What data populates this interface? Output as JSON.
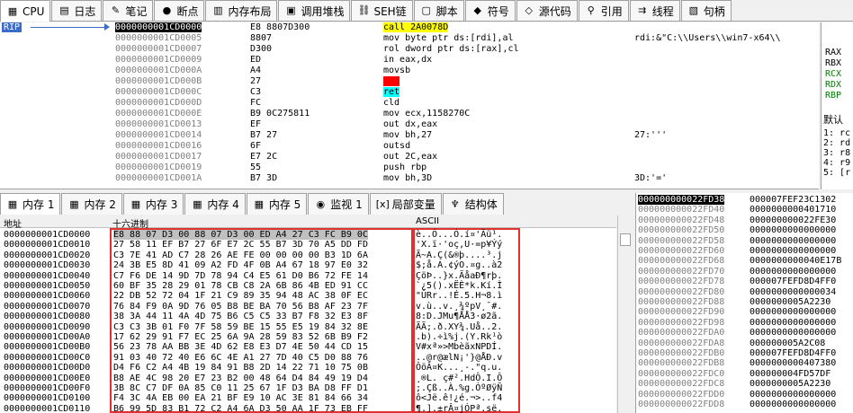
{
  "top_tabs": [
    {
      "label": "CPU",
      "icon": "cpu-icon",
      "glyph": "▦",
      "active": true
    },
    {
      "label": "日志",
      "icon": "log-icon",
      "glyph": "▤"
    },
    {
      "label": "笔记",
      "icon": "notes-icon",
      "glyph": "✎"
    },
    {
      "label": "断点",
      "icon": "breakpoint-icon",
      "glyph": "●"
    },
    {
      "label": "内存布局",
      "icon": "memory-map-icon",
      "glyph": "▥"
    },
    {
      "label": "调用堆栈",
      "icon": "call-stack-icon",
      "glyph": "▣"
    },
    {
      "label": "SEH链",
      "icon": "seh-icon",
      "glyph": "⛓"
    },
    {
      "label": "脚本",
      "icon": "script-icon",
      "glyph": "▢"
    },
    {
      "label": "符号",
      "icon": "symbol-icon",
      "glyph": "◆"
    },
    {
      "label": "源代码",
      "icon": "source-icon",
      "glyph": "◇"
    },
    {
      "label": "引用",
      "icon": "references-icon",
      "glyph": "⚲"
    },
    {
      "label": "线程",
      "icon": "threads-icon",
      "glyph": "⇉"
    },
    {
      "label": "句柄",
      "icon": "handles-icon",
      "glyph": "▧"
    }
  ],
  "rip_label": "RIP",
  "disasm": [
    {
      "addr": "0000000001CD0000",
      "bytes": "E8 8807D300",
      "instr": "call 2A0078D",
      "comment": "",
      "sel": true
    },
    {
      "addr": "0000000001CD0005",
      "bytes": "8807",
      "instr": "mov byte ptr ds:[rdi],al",
      "comment": "rdi:&\"C:\\\\Users\\\\win7-x64\\\\"
    },
    {
      "addr": "0000000001CD0007",
      "bytes": "D300",
      "instr": "rol dword ptr ds:[rax],cl",
      "comment": ""
    },
    {
      "addr": "0000000001CD0009",
      "bytes": "ED",
      "instr": "in eax,dx",
      "comment": ""
    },
    {
      "addr": "0000000001CD000A",
      "bytes": "A4",
      "instr": "movsb",
      "comment": ""
    },
    {
      "addr": "0000000001CD000B",
      "bytes": "27",
      "instr": "???",
      "comment": "",
      "bad": true
    },
    {
      "addr": "0000000001CD000C",
      "bytes": "C3",
      "instr": "ret",
      "comment": "",
      "ret": true
    },
    {
      "addr": "0000000001CD000D",
      "bytes": "FC",
      "instr": "cld",
      "comment": ""
    },
    {
      "addr": "0000000001CD000E",
      "bytes": "B9 0C275811",
      "instr": "mov ecx,1158270C",
      "comment": ""
    },
    {
      "addr": "0000000001CD0013",
      "bytes": "EF",
      "instr": "out dx,eax",
      "comment": ""
    },
    {
      "addr": "0000000001CD0014",
      "bytes": "B7 27",
      "instr": "mov bh,27",
      "comment": "27:'''"
    },
    {
      "addr": "0000000001CD0016",
      "bytes": "6F",
      "instr": "outsd",
      "comment": ""
    },
    {
      "addr": "0000000001CD0017",
      "bytes": "E7 2C",
      "instr": "out 2C,eax",
      "comment": ""
    },
    {
      "addr": "0000000001CD0019",
      "bytes": "55",
      "instr": "push rbp",
      "comment": ""
    },
    {
      "addr": "0000000001CD001A",
      "bytes": "B7 3D",
      "instr": "mov bh,3D",
      "comment": "3D:'='"
    }
  ],
  "registers": [
    "RAX",
    "RBX",
    "RCX",
    "RDX",
    "RBP"
  ],
  "reg_tab": "默认",
  "reg_args": [
    "1: rc",
    "2: rd",
    "3: r8",
    "4: r9",
    "5: [r"
  ],
  "mid_tabs": [
    {
      "label": "内存 1",
      "icon": "memory-icon",
      "glyph": "▦",
      "active": true
    },
    {
      "label": "内存 2",
      "icon": "memory-icon",
      "glyph": "▦"
    },
    {
      "label": "内存 3",
      "icon": "memory-icon",
      "glyph": "▦"
    },
    {
      "label": "内存 4",
      "icon": "memory-icon",
      "glyph": "▦"
    },
    {
      "label": "内存 5",
      "icon": "memory-icon",
      "glyph": "▦"
    },
    {
      "label": "监视 1",
      "icon": "watch-icon",
      "glyph": "◉"
    },
    {
      "label": "局部变量",
      "icon": "locals-icon",
      "glyph": "[x]"
    },
    {
      "label": "结构体",
      "icon": "struct-icon",
      "glyph": "♆"
    }
  ],
  "mem_headers": {
    "addr": "地址",
    "hex": "十六进制",
    "ascii": "ASCII"
  },
  "mem": [
    {
      "addr": "0000000001CD0000",
      "hex": "E8 88 07 D3 00 88 07 D3 00 ED A4 27 C3 FC B9 0C",
      "ascii": "è..Ó...Ó.í¤'Ãü¹."
    },
    {
      "addr": "0000000001CD0010",
      "hex": "27 58 11 EF B7 27 6F E7 2C 55 B7 3D 70 A5 DD FD",
      "ascii": "'X.ï·'oç,U·=p¥Ýý"
    },
    {
      "addr": "0000000001CD0020",
      "hex": "C3 7E 41 AD C7 28 26 AE FE 00 00 00 00 B3 1D 6A",
      "ascii": "Ã~A.Ç(&®þ....³.j"
    },
    {
      "addr": "0000000001CD0030",
      "hex": "24 3B E5 8D 41 09 A2 FD 4F 0B A4 67 18 97 E0 32",
      "ascii": "$;å.A.¢ýO.¤g..à2"
    },
    {
      "addr": "0000000001CD0040",
      "hex": "C7 F6 DE 14 9D 7D 78 94 C4 E5 61 D0 B6 72 FE 14",
      "ascii": "ÇöÞ..}x.ÄåaÐ¶rþ."
    },
    {
      "addr": "0000000001CD0050",
      "hex": "60 BF 35 28 29 01 78 CB C8 2A 6B 86 4B ED 91 CC",
      "ascii": "`¿5().xËÈ*k.Kí.Ì"
    },
    {
      "addr": "0000000001CD0060",
      "hex": "22 DB 52 72 04 1F 21 C9 89 35 94 48 AC 38 0F EC",
      "ascii": "\"ÛRr..!É.5.H¬8.ì"
    },
    {
      "addr": "0000000001CD0070",
      "hex": "76 84 F9 0A 9D 76 05 B8 BE BA 70 56 B8 AF 23 7F",
      "ascii": "v.ù..v.¸¾ºpV¸¯#."
    },
    {
      "addr": "0000000001CD0080",
      "hex": "38 3A 44 11 4A 4D 75 B6 C5 C5 33 B7 F8 32 E3 8F",
      "ascii": "8:D.JMu¶ÅÅ3·ø2ã."
    },
    {
      "addr": "0000000001CD0090",
      "hex": "C3 C3 3B 01 F0 7F 58 59 BE 15 55 E5 19 84 32 8E",
      "ascii": "ÃÃ;.ð.XY¾.Uå..2."
    },
    {
      "addr": "0000000001CD00A0",
      "hex": "17 62 29 91 F7 EC 25 6A 9A 28 59 83 52 6B B9 F2",
      "ascii": ".b).÷ì%j.(Y.Rk¹ò"
    },
    {
      "addr": "0000000001CD00B0",
      "hex": "56 23 78 AA BB 3E 4D 62 E8 E3 D7 4E 50 44 CD 15",
      "ascii": "V#xª»>MbèãxNPDÍ."
    },
    {
      "addr": "0000000001CD00C0",
      "hex": "91 03 40 72 40 E6 6C 4E A1 27 7D 40 C5 D0 88 76",
      "ascii": "..@r@ælN¡'}@ÅÐ.v"
    },
    {
      "addr": "0000000001CD00D0",
      "hex": "D4 F6 C2 A4 4B 19 84 91 B8 2D 14 22 71 10 75 0B",
      "ascii": "ÔöÂ¤K...¸-.\"q.u."
    },
    {
      "addr": "0000000001CD00E0",
      "hex": "B8 AE 4C 98 20 E7 23 B2 00 48 64 D4 84 49 19 D4",
      "ascii": "¸®L. ç#².HdÔ.I.Ô"
    },
    {
      "addr": "0000000001CD00F0",
      "hex": "3B 8C C7 DF 0A 85 C0 11 25 67 1F D3 BA D8 FF D1",
      "ascii": ";.Çß..À.%g.ÓºØÿÑ"
    },
    {
      "addr": "0000000001CD0100",
      "hex": "F4 3C 4A EB 00 EA 21 BF E9 10 AC 3E 81 84 66 34",
      "ascii": "ô<Jë.ê!¿é.¬>..f4"
    },
    {
      "addr": "0000000001CD0110",
      "hex": "B6 99 5D 83 B1 72 C2 A4 6A D3 50 AA 1F 73 EB FF",
      "ascii": "¶.].±rÂ¤jÓPª.së."
    }
  ],
  "stack": [
    {
      "addr": "000000000022FD38",
      "val": "000007FEF23C1302",
      "sel": true
    },
    {
      "addr": "000000000022FD40",
      "val": "0000000000401710"
    },
    {
      "addr": "000000000022FD48",
      "val": "000000000022FE30"
    },
    {
      "addr": "000000000022FD50",
      "val": "0000000000000000"
    },
    {
      "addr": "000000000022FD58",
      "val": "0000000000000000"
    },
    {
      "addr": "000000000022FD60",
      "val": "0000000000000000"
    },
    {
      "addr": "000000000022FD68",
      "val": "0000000000040E17B"
    },
    {
      "addr": "000000000022FD70",
      "val": "0000000000000000"
    },
    {
      "addr": "000000000022FD78",
      "val": "000007FEFD8D4FF0"
    },
    {
      "addr": "000000000022FD80",
      "val": "0000000000000034"
    },
    {
      "addr": "000000000022FD88",
      "val": "0000000005A2230"
    },
    {
      "addr": "000000000022FD90",
      "val": "0000000000000000"
    },
    {
      "addr": "000000000022FD98",
      "val": "0000000000000000"
    },
    {
      "addr": "000000000022FDA0",
      "val": "0000000000000000"
    },
    {
      "addr": "000000000022FDA8",
      "val": "000000005A2C08"
    },
    {
      "addr": "000000000022FDB0",
      "val": "000007FEFD8D4FF0"
    },
    {
      "addr": "000000000022FDB8",
      "val": "0000000000407380"
    },
    {
      "addr": "000000000022FDC0",
      "val": "000000004FD57DF"
    },
    {
      "addr": "000000000022FDC8",
      "val": "0000000005A2230"
    },
    {
      "addr": "000000000022FDD0",
      "val": "0000000000000000"
    },
    {
      "addr": "000000000022FDD8",
      "val": "0000000000000000"
    }
  ],
  "colors": {
    "rip": "#3d6cc8",
    "selected": "#000000",
    "call_bg": "#ffff00",
    "ret_bg": "#00ffff",
    "bad_bg": "#ff0000",
    "highlight": "#e03030"
  }
}
